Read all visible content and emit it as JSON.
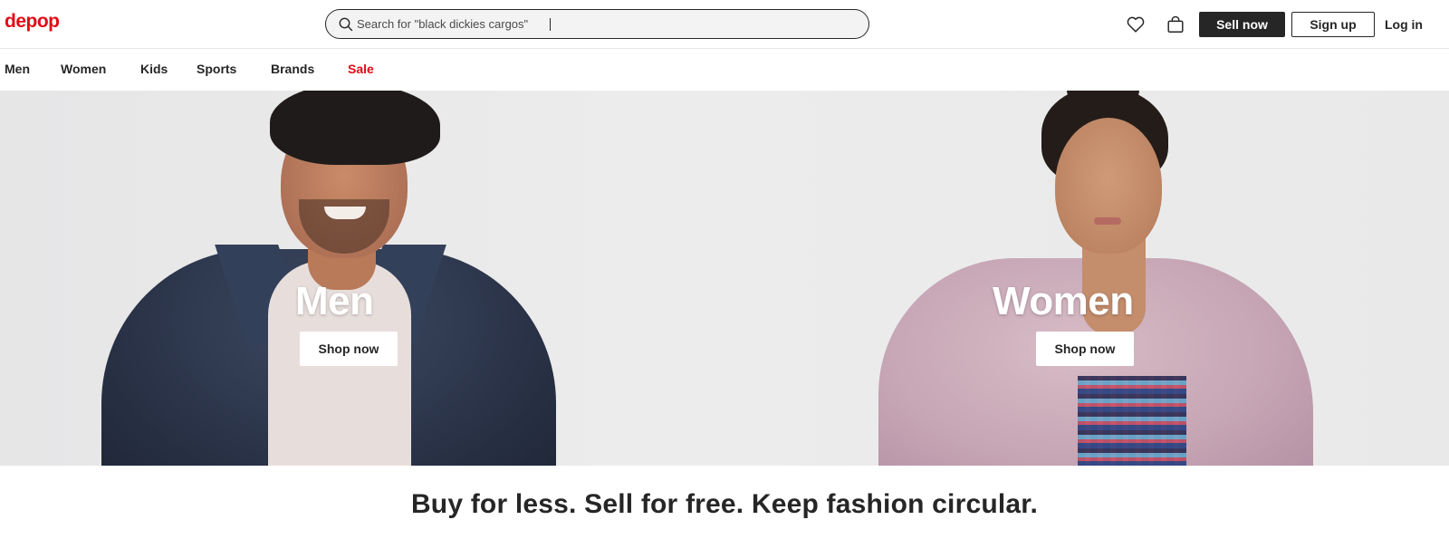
{
  "header": {
    "logo": "depop",
    "search": {
      "placeholder": "Search for \"black dickies cargos\"",
      "icon": "search-icon"
    },
    "icons": [
      "heart-icon",
      "bag-icon"
    ],
    "sell_label": "Sell now",
    "signup_label": "Sign up",
    "login_label": "Log in"
  },
  "nav": {
    "items": [
      "Men",
      "Women",
      "Kids",
      "Sports",
      "Brands",
      "Sale"
    ]
  },
  "hero": {
    "men": {
      "title": "Men",
      "button": "Shop now"
    },
    "women": {
      "title": "Women",
      "button": "Shop now"
    }
  },
  "tagline": "Buy for less. Sell for free. Keep fashion circular.",
  "colors": {
    "brand": "#e10b17",
    "text": "#262626",
    "hero_bg": "#e8e8e9"
  }
}
